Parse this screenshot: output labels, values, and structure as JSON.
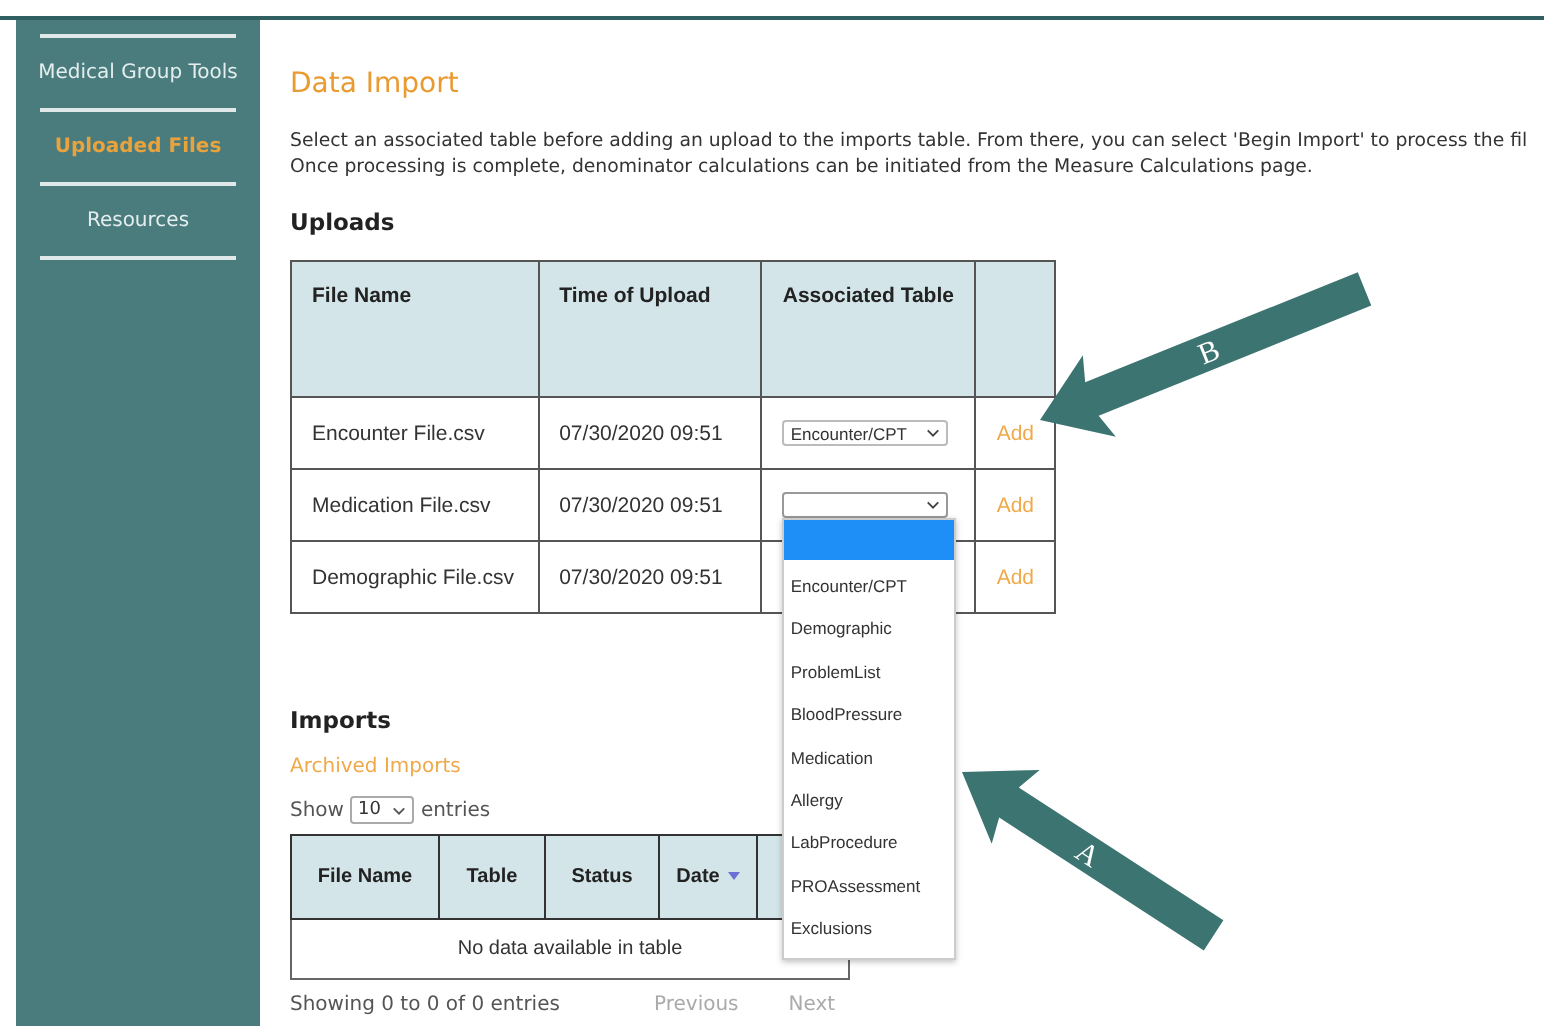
{
  "sidebar": {
    "items": [
      {
        "label": "Medical Group Tools",
        "selected": false
      },
      {
        "label": "Uploaded Files",
        "selected": true
      },
      {
        "label": "Resources",
        "selected": false
      }
    ]
  },
  "page": {
    "title": "Data Import",
    "intro": [
      "Select an associated table before adding an upload to the imports table. From there, you can select 'Begin Import' to process the fil",
      "Once processing is complete, denominator calculations can be initiated from the Measure Calculations page."
    ]
  },
  "uploads": {
    "heading": "Uploads",
    "columns": [
      "File Name",
      "Time of Upload",
      "Associated Table"
    ],
    "rows": [
      {
        "file": "Encounter File.csv",
        "time": "07/30/2020 09:51",
        "table": "Encounter/CPT",
        "open": false,
        "action": "Add"
      },
      {
        "file": "Medication File.csv",
        "time": "07/30/2020 09:51",
        "open": true,
        "action": "Add"
      },
      {
        "file": "Demographic File.csv",
        "time": "07/30/2020 09:51",
        "open": false,
        "action": "Add"
      }
    ]
  },
  "dropdown": {
    "blank_highlighted": true,
    "options": [
      "Encounter/CPT",
      "Demographic",
      "ProblemList",
      "BloodPressure",
      "Medication",
      "Allergy",
      "LabProcedure",
      "PROAssessment",
      "Exclusions"
    ]
  },
  "imports": {
    "heading": "Imports",
    "archive_link": "Archived Imports",
    "show_label": "Show",
    "page_size": "10",
    "entries_label": "entries",
    "columns": [
      {
        "label": "File Name",
        "sorted": false
      },
      {
        "label": "Table",
        "sorted": false
      },
      {
        "label": "Status",
        "sorted": false
      },
      {
        "label": "Date",
        "sorted": true
      }
    ],
    "empty_message": "No data available in table",
    "summary": "Showing 0 to 0 of 0 entries",
    "pager": [
      {
        "label": "Previous",
        "disabled": true
      },
      {
        "label": "Next",
        "disabled": true
      }
    ]
  },
  "annotations": [
    {
      "label": "B"
    },
    {
      "label": "A"
    }
  ]
}
